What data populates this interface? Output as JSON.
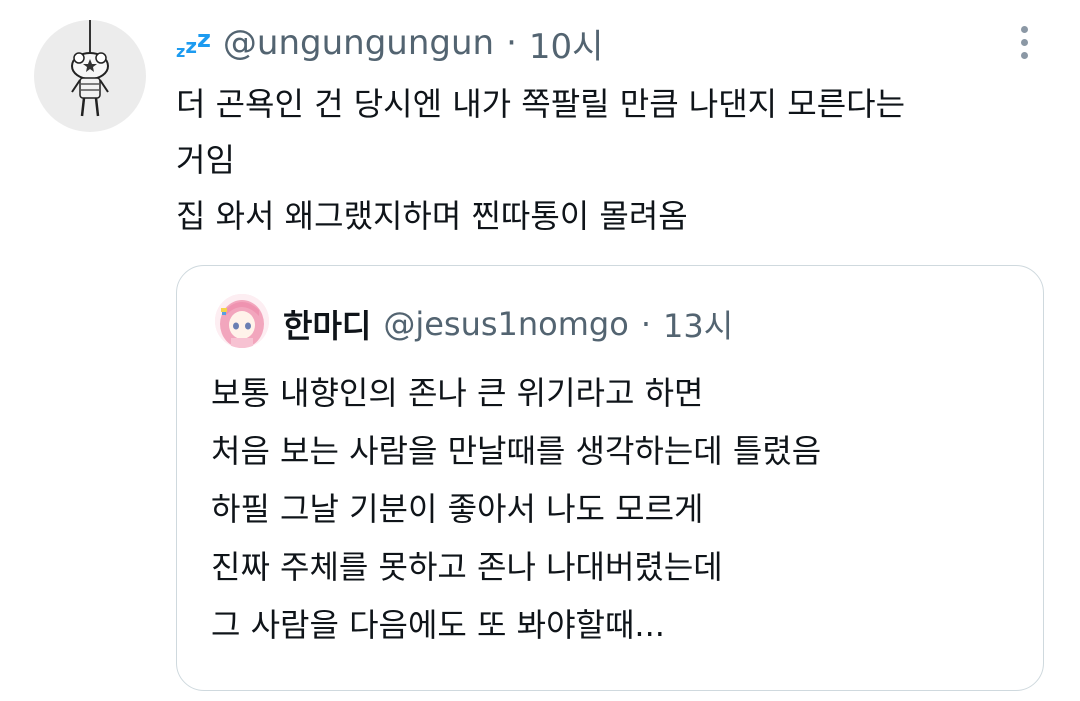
{
  "tweet": {
    "status_emoji": "zzz-icon",
    "handle": "@ungungungun",
    "separator": "·",
    "time": "10시",
    "text": "더 곤욕인 건 당시엔 내가 쪽팔릴 만큼 나댄지 모른다는\n거임\n집 와서 왜그랬지하며 찐따통이 몰려옴"
  },
  "quote": {
    "display_name": "한마디",
    "handle": "@jesus1nomgo",
    "separator": "·",
    "time": "13시",
    "text": "보통 내향인의 존나 큰 위기라고 하면\n처음 보는 사람을 만날때를 생각하는데 틀렸음\n하필 그날 기분이 좋아서 나도 모르게\n진짜 주체를 못하고 존나 나대버렸는데\n그 사람을 다음에도 또 봐야할때..."
  },
  "colors": {
    "text": "#0f1419",
    "secondary": "#536471",
    "accent": "#1d9bf0",
    "border": "#cfd9de"
  }
}
